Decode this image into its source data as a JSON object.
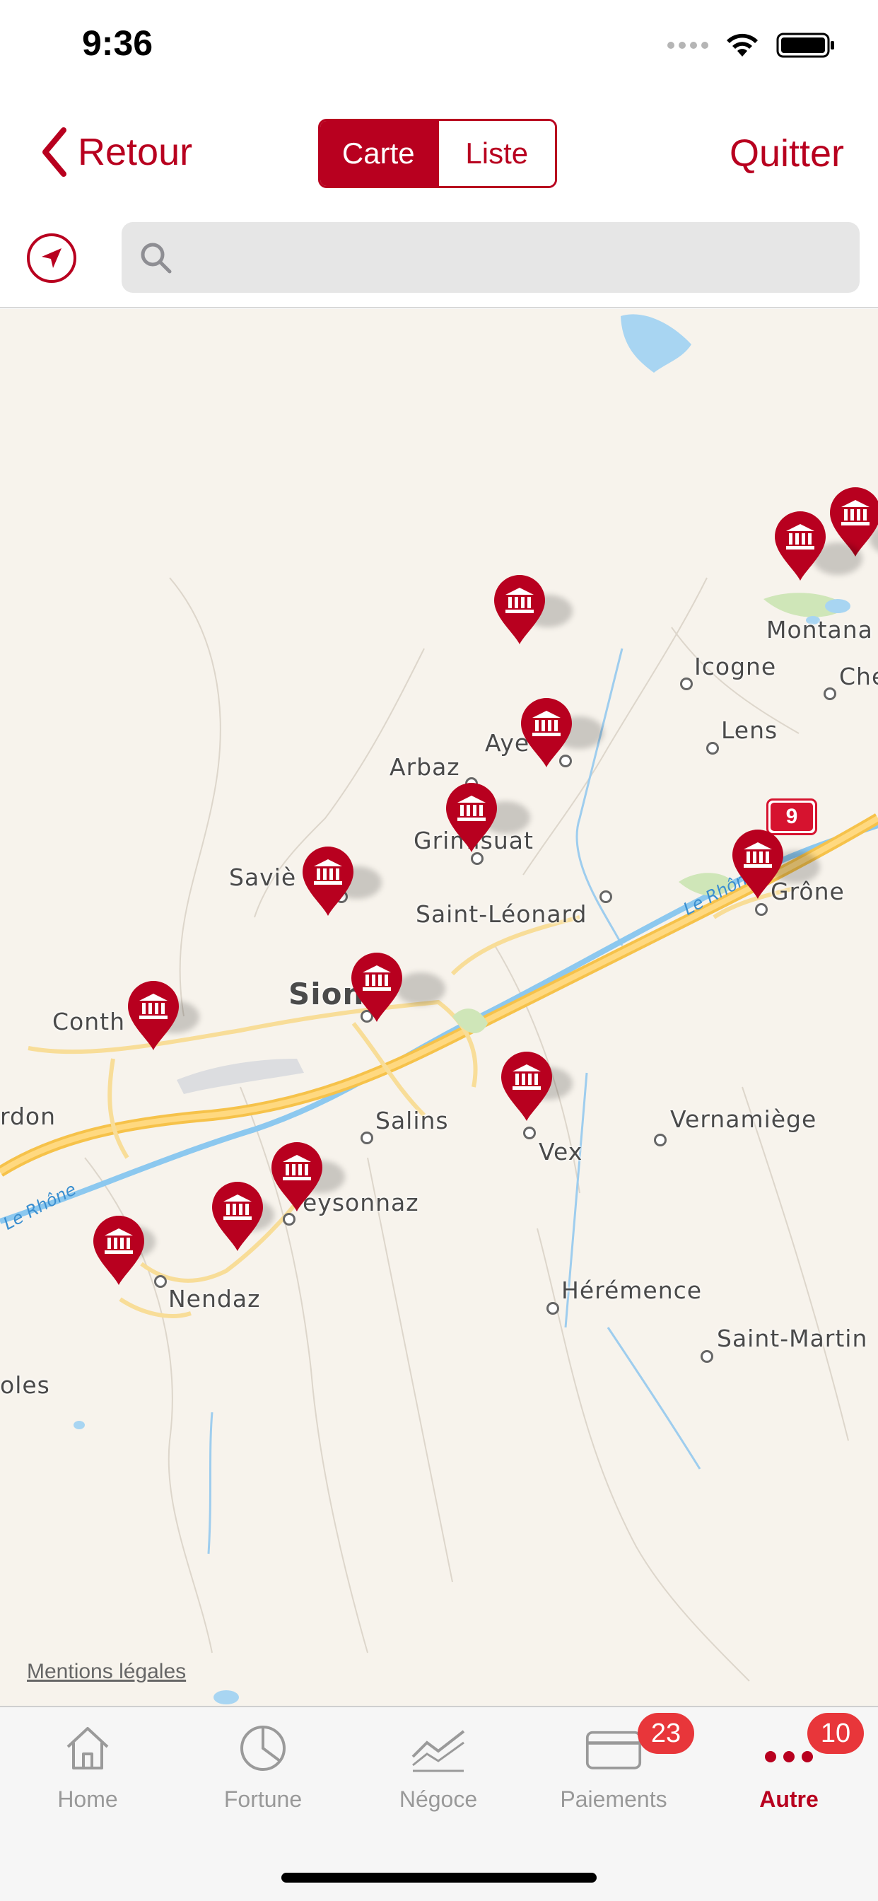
{
  "status_bar": {
    "time": "9:36"
  },
  "nav": {
    "back_label": "Retour",
    "segments": [
      {
        "label": "Carte",
        "active": true
      },
      {
        "label": "Liste",
        "active": false
      }
    ],
    "quit_label": "Quitter"
  },
  "search": {
    "placeholder": "",
    "value": ""
  },
  "map": {
    "places": [
      {
        "name": "Montana",
        "big": false
      },
      {
        "name": "Icogne",
        "big": false
      },
      {
        "name": "Che",
        "big": false
      },
      {
        "name": "Lens",
        "big": false
      },
      {
        "name": "Aye",
        "big": false
      },
      {
        "name": "Arbaz",
        "big": false
      },
      {
        "name": "Grimisuat",
        "big": false
      },
      {
        "name": "Saviè",
        "big": false
      },
      {
        "name": "Saint-Léonard",
        "big": false
      },
      {
        "name": "Grône",
        "big": false
      },
      {
        "name": "Sion",
        "big": true
      },
      {
        "name": "Conth",
        "big": false
      },
      {
        "name": "rdon",
        "big": false
      },
      {
        "name": "Salins",
        "big": false
      },
      {
        "name": "Vex",
        "big": false
      },
      {
        "name": "Vernamiège",
        "big": false
      },
      {
        "name": "eysonnaz",
        "big": false
      },
      {
        "name": "Nendaz",
        "big": false
      },
      {
        "name": "Hérémence",
        "big": false
      },
      {
        "name": "Saint-Martin",
        "big": false
      },
      {
        "name": "oles",
        "big": false
      }
    ],
    "river_labels": [
      "Le Rhône",
      "Le Rhône"
    ],
    "route_number": "9",
    "legal_link": "Mentions légales"
  },
  "tabs": [
    {
      "label": "Home",
      "icon": "home-icon",
      "badge": "",
      "active": false
    },
    {
      "label": "Fortune",
      "icon": "pie-chart-icon",
      "badge": "",
      "active": false
    },
    {
      "label": "Négoce",
      "icon": "trend-chart-icon",
      "badge": "",
      "active": false
    },
    {
      "label": "Paiements",
      "icon": "credit-card-icon",
      "badge": "23",
      "active": false
    },
    {
      "label": "Autre",
      "icon": "more-dots-icon",
      "badge": "10",
      "active": true
    }
  ],
  "colors": {
    "accent": "#b8001f",
    "badge": "#e8363a",
    "map_bg": "#f7f3ec",
    "road": "#f6c24a"
  }
}
